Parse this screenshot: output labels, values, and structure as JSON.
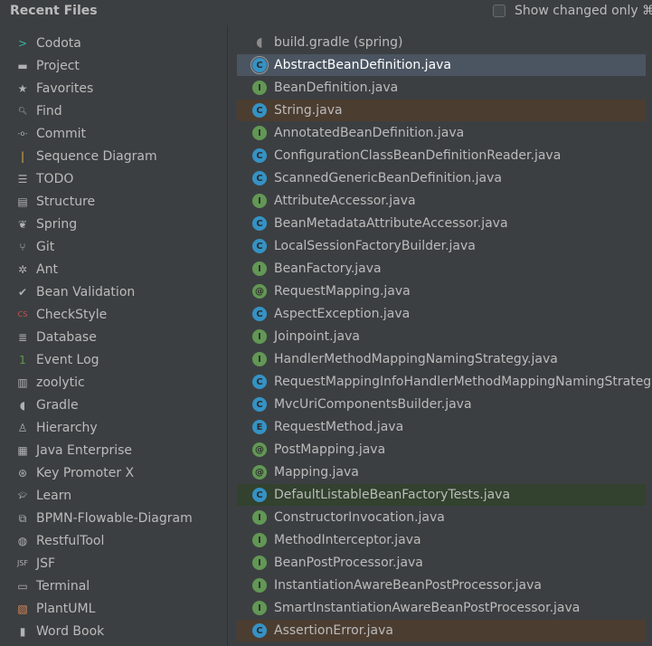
{
  "header": {
    "title": "Recent Files",
    "show_changed_label": "Show changed only ⌘E"
  },
  "colors": {
    "background": "#3c3f41",
    "selection": "#4b5561",
    "accent_blue": "#3592c4",
    "accent_green": "#629755"
  },
  "tool_windows": [
    {
      "label": "Codota",
      "icon": "codota-icon",
      "glyph": ">",
      "color": "#2fb5a6"
    },
    {
      "label": "Project",
      "icon": "folder-icon",
      "glyph": "▬",
      "color": "#afb1b3"
    },
    {
      "label": "Favorites",
      "icon": "star-icon",
      "glyph": "★",
      "color": "#afb1b3"
    },
    {
      "label": "Find",
      "icon": "search-icon",
      "glyph": "🔍︎",
      "color": "#afb1b3"
    },
    {
      "label": "Commit",
      "icon": "commit-icon",
      "glyph": "-o-",
      "color": "#afb1b3"
    },
    {
      "label": "Sequence Diagram",
      "icon": "sequence-diagram-icon",
      "glyph": "|",
      "color": "#e0b24d"
    },
    {
      "label": "TODO",
      "icon": "todo-list-icon",
      "glyph": "☰",
      "color": "#afb1b3"
    },
    {
      "label": "Structure",
      "icon": "structure-icon",
      "glyph": "▤",
      "color": "#afb1b3"
    },
    {
      "label": "Spring",
      "icon": "spring-leaf-icon",
      "glyph": "❦",
      "color": "#afb1b3"
    },
    {
      "label": "Git",
      "icon": "git-branch-icon",
      "glyph": "⑂",
      "color": "#afb1b3"
    },
    {
      "label": "Ant",
      "icon": "ant-icon",
      "glyph": "✲",
      "color": "#afb1b3"
    },
    {
      "label": "Bean Validation",
      "icon": "bean-validation-icon",
      "glyph": "✔",
      "color": "#afb1b3"
    },
    {
      "label": "CheckStyle",
      "icon": "checkstyle-icon",
      "glyph": "CS",
      "color": "#c75450"
    },
    {
      "label": "Database",
      "icon": "database-icon",
      "glyph": "≣",
      "color": "#afb1b3"
    },
    {
      "label": "Event Log",
      "icon": "event-log-icon",
      "glyph": "1",
      "color": "#5a9e4b"
    },
    {
      "label": "zoolytic",
      "icon": "zoolytic-icon",
      "glyph": "▥",
      "color": "#afb1b3"
    },
    {
      "label": "Gradle",
      "icon": "gradle-elephant-icon",
      "glyph": "◖",
      "color": "#afb1b3"
    },
    {
      "label": "Hierarchy",
      "icon": "hierarchy-icon",
      "glyph": "♙",
      "color": "#afb1b3"
    },
    {
      "label": "Java Enterprise",
      "icon": "java-enterprise-icon",
      "glyph": "▦",
      "color": "#afb1b3"
    },
    {
      "label": "Key Promoter X",
      "icon": "key-promoter-icon",
      "glyph": "⊛",
      "color": "#afb1b3"
    },
    {
      "label": "Learn",
      "icon": "learn-cap-icon",
      "glyph": "🎓︎",
      "color": "#afb1b3"
    },
    {
      "label": "BPMN-Flowable-Diagram",
      "icon": "bpmn-diagram-icon",
      "glyph": "⧉",
      "color": "#afb1b3"
    },
    {
      "label": "RestfulTool",
      "icon": "globe-icon",
      "glyph": "◍",
      "color": "#afb1b3"
    },
    {
      "label": "JSF",
      "icon": "jsf-icon",
      "glyph": "JSF",
      "color": "#afb1b3"
    },
    {
      "label": "Terminal",
      "icon": "terminal-icon",
      "glyph": "▭",
      "color": "#afb1b3"
    },
    {
      "label": "PlantUML",
      "icon": "plantuml-icon",
      "glyph": "▧",
      "color": "#d98a5a"
    },
    {
      "label": "Word Book",
      "icon": "word-book-icon",
      "glyph": "▮",
      "color": "#afb1b3"
    }
  ],
  "recent_files": [
    {
      "name": "build.gradle (spring)",
      "type": "gradle",
      "badge": "◖",
      "state": ""
    },
    {
      "name": "AbstractBeanDefinition.java",
      "type": "abstract-class",
      "badge": "C",
      "state": "selected"
    },
    {
      "name": "BeanDefinition.java",
      "type": "interface",
      "badge": "I",
      "state": ""
    },
    {
      "name": "String.java",
      "type": "class-locked",
      "badge": "C",
      "state": "readonly"
    },
    {
      "name": "AnnotatedBeanDefinition.java",
      "type": "interface",
      "badge": "I",
      "state": ""
    },
    {
      "name": "ConfigurationClassBeanDefinitionReader.java",
      "type": "class",
      "badge": "C",
      "state": ""
    },
    {
      "name": "ScannedGenericBeanDefinition.java",
      "type": "class",
      "badge": "C",
      "state": ""
    },
    {
      "name": "AttributeAccessor.java",
      "type": "interface",
      "badge": "I",
      "state": ""
    },
    {
      "name": "BeanMetadataAttributeAccessor.java",
      "type": "class",
      "badge": "C",
      "state": ""
    },
    {
      "name": "LocalSessionFactoryBuilder.java",
      "type": "class",
      "badge": "C",
      "state": ""
    },
    {
      "name": "BeanFactory.java",
      "type": "interface",
      "badge": "I",
      "state": ""
    },
    {
      "name": "RequestMapping.java",
      "type": "annotation",
      "badge": "@",
      "state": ""
    },
    {
      "name": "AspectException.java",
      "type": "class",
      "badge": "C",
      "state": ""
    },
    {
      "name": "Joinpoint.java",
      "type": "interface",
      "badge": "I",
      "state": ""
    },
    {
      "name": "HandlerMethodMappingNamingStrategy.java",
      "type": "interface",
      "badge": "I",
      "state": ""
    },
    {
      "name": "RequestMappingInfoHandlerMethodMappingNamingStrategy.ja",
      "type": "class",
      "badge": "C",
      "state": ""
    },
    {
      "name": "MvcUriComponentsBuilder.java",
      "type": "class",
      "badge": "C",
      "state": ""
    },
    {
      "name": "RequestMethod.java",
      "type": "enum",
      "badge": "E",
      "state": ""
    },
    {
      "name": "PostMapping.java",
      "type": "annotation",
      "badge": "@",
      "state": ""
    },
    {
      "name": "Mapping.java",
      "type": "annotation",
      "badge": "@",
      "state": ""
    },
    {
      "name": "DefaultListableBeanFactoryTests.java",
      "type": "test-class",
      "badge": "C",
      "state": "test"
    },
    {
      "name": "ConstructorInvocation.java",
      "type": "interface",
      "badge": "I",
      "state": ""
    },
    {
      "name": "MethodInterceptor.java",
      "type": "interface",
      "badge": "I",
      "state": ""
    },
    {
      "name": "BeanPostProcessor.java",
      "type": "interface",
      "badge": "I",
      "state": ""
    },
    {
      "name": "InstantiationAwareBeanPostProcessor.java",
      "type": "interface",
      "badge": "I",
      "state": ""
    },
    {
      "name": "SmartInstantiationAwareBeanPostProcessor.java",
      "type": "interface",
      "badge": "I",
      "state": ""
    },
    {
      "name": "AssertionError.java",
      "type": "class-locked",
      "badge": "C",
      "state": "readonly"
    }
  ]
}
